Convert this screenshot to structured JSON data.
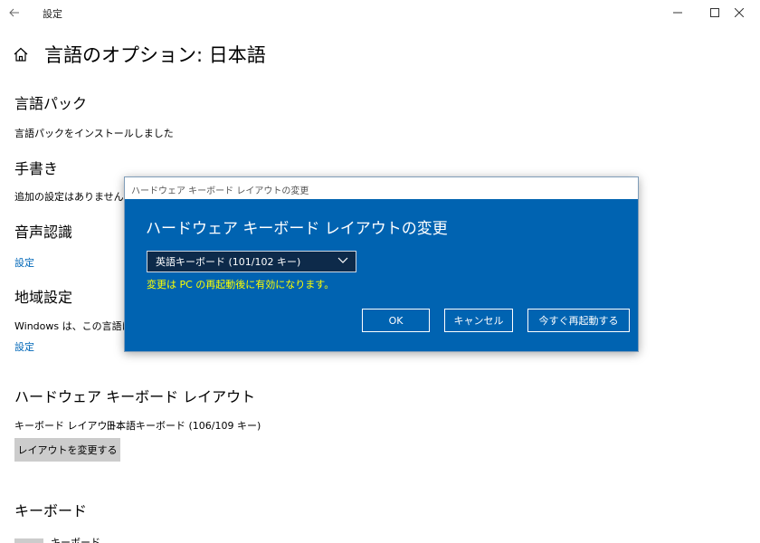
{
  "window": {
    "app_title": "設定",
    "icons": [
      "back-arrow-icon",
      "minimize-icon",
      "maximize-icon",
      "close-icon"
    ]
  },
  "page": {
    "title": "言語のオプション: 日本語",
    "home_icon": "home-icon"
  },
  "sections": {
    "language_pack": {
      "heading": "言語パック",
      "status": "言語パックをインストールしました"
    },
    "handwriting": {
      "heading": "手書き",
      "status": "追加の設定はありません"
    },
    "speech": {
      "heading": "音声認識",
      "link": "設定"
    },
    "region": {
      "heading": "地域設定",
      "text": "Windows は、この言語に基",
      "link": "設定"
    },
    "hardware_keyboard": {
      "heading": "ハードウェア キーボード レイアウト",
      "label": "キーボード レイアウト:",
      "value": "日本語キーボード (106/109 キー)",
      "button": "レイアウトを変更する"
    },
    "keyboard": {
      "heading": "キーボード",
      "partial_item": "キーボード"
    }
  },
  "dialog": {
    "window_title": "ハードウェア キーボード レイアウトの変更",
    "heading": "ハードウェア キーボード レイアウトの変更",
    "selected_layout": "英語キーボード (101/102 キー)",
    "note": "変更は PC の再起動後に有効になります。",
    "buttons": {
      "ok": "OK",
      "cancel": "キャンセル",
      "restart": "今すぐ再起動する"
    },
    "colors": {
      "background": "#0063b1",
      "note": "#ffff00",
      "select_bg": "#0d2a4a"
    }
  },
  "colors": {
    "link": "#0067b8",
    "button_gray": "#cccccc"
  }
}
